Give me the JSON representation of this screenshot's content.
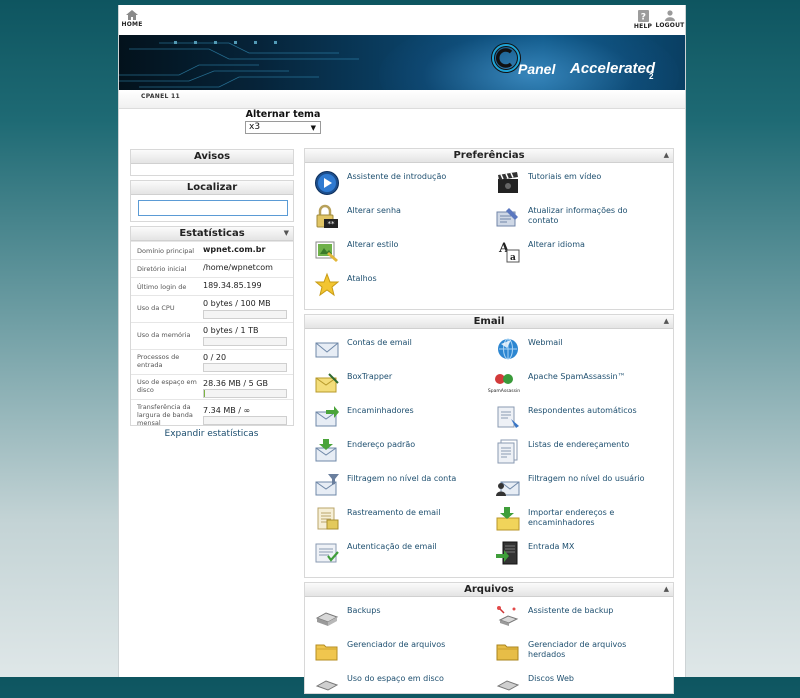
{
  "topbar": {
    "home": "HOME",
    "help": "HELP",
    "logout": "LOGOUT"
  },
  "banner": {
    "brand_c": "c",
    "brand_panel": "Panel",
    "brand_accelerated": "Accelerated",
    "brand_version": "2"
  },
  "subnav": {
    "crumb": "CPANEL 11"
  },
  "theme": {
    "label": "Alternar tema",
    "selected": "x3"
  },
  "avisos": {
    "title": "Avisos"
  },
  "localizar": {
    "title": "Localizar",
    "search_value": ""
  },
  "estatisticas": {
    "title": "Estatísticas",
    "rows": [
      {
        "key": "Domínio principal",
        "value": "wpnet.com.br"
      },
      {
        "key": "Diretório inicial",
        "value": "/home/wpnetcom"
      },
      {
        "key": "Último login de",
        "value": "189.34.85.199"
      },
      {
        "key": "Uso da CPU",
        "value": "0 bytes / 100 MB",
        "usage": 0
      },
      {
        "key": "Uso da memória",
        "value": "0 bytes / 1 TB",
        "usage": 0
      },
      {
        "key": "Processos de entrada",
        "value": "0 / 20",
        "usage": 0
      },
      {
        "key": "Uso de espaço em disco",
        "value": "28.36 MB / 5 GB",
        "usage": 0.006
      },
      {
        "key": "Transferência da largura de banda mensal",
        "value": "7.34 MB / ∞",
        "usage": 0
      }
    ],
    "expand": "Expandir estatísticas"
  },
  "preferencias": {
    "title": "Preferências",
    "items": [
      {
        "label": "Assistente de introdução",
        "icon": "play-icon"
      },
      {
        "label": "Tutoriais em vídeo",
        "icon": "clapperboard-icon"
      },
      {
        "label": "Alterar senha",
        "icon": "padlock-icon"
      },
      {
        "label": "Atualizar informações do contato",
        "icon": "contact-card-icon"
      },
      {
        "label": "Alterar estilo",
        "icon": "style-palette-icon"
      },
      {
        "label": "Alterar idioma",
        "icon": "language-icon"
      },
      {
        "label": "Atalhos",
        "icon": "star-icon"
      }
    ]
  },
  "email": {
    "title": "Email",
    "items": [
      {
        "label": "Contas de email",
        "icon": "envelope-icon"
      },
      {
        "label": "Webmail",
        "icon": "webmail-globe-icon"
      },
      {
        "label": "BoxTrapper",
        "icon": "boxtrapper-icon"
      },
      {
        "label": "Apache SpamAssassin™",
        "icon": "spamassassin-icon",
        "icon_text": "SpamAssassin"
      },
      {
        "label": "Encaminhadores",
        "icon": "forward-mail-icon"
      },
      {
        "label": "Respondentes automáticos",
        "icon": "autoresponder-icon"
      },
      {
        "label": "Endereço padrão",
        "icon": "default-address-icon"
      },
      {
        "label": "Listas de endereçamento",
        "icon": "mailing-list-icon"
      },
      {
        "label": "Filtragem no nível da conta",
        "icon": "account-filter-icon"
      },
      {
        "label": "Filtragem no nível do usuário",
        "icon": "user-filter-icon"
      },
      {
        "label": "Rastreamento de email",
        "icon": "email-trace-icon"
      },
      {
        "label": "Importar endereços e encaminhadores",
        "icon": "import-icon"
      },
      {
        "label": "Autenticação de email",
        "icon": "email-auth-icon"
      },
      {
        "label": "Entrada MX",
        "icon": "mx-entry-icon"
      }
    ]
  },
  "arquivos": {
    "title": "Arquivos",
    "items": [
      {
        "label": "Backups",
        "icon": "backup-drive-icon"
      },
      {
        "label": "Assistente de backup",
        "icon": "backup-wizard-icon"
      },
      {
        "label": "Gerenciador de arquivos",
        "icon": "folder-icon"
      },
      {
        "label": "Gerenciador de arquivos herdados",
        "icon": "legacy-folder-icon"
      },
      {
        "label": "Uso do espaço em disco",
        "icon": "disk-usage-icon"
      },
      {
        "label": "Discos Web",
        "icon": "web-disk-icon"
      }
    ]
  },
  "colors": {
    "link": "#1e4f6f",
    "header_bg": "#e4e4e4",
    "page_top": "#0e5560"
  }
}
